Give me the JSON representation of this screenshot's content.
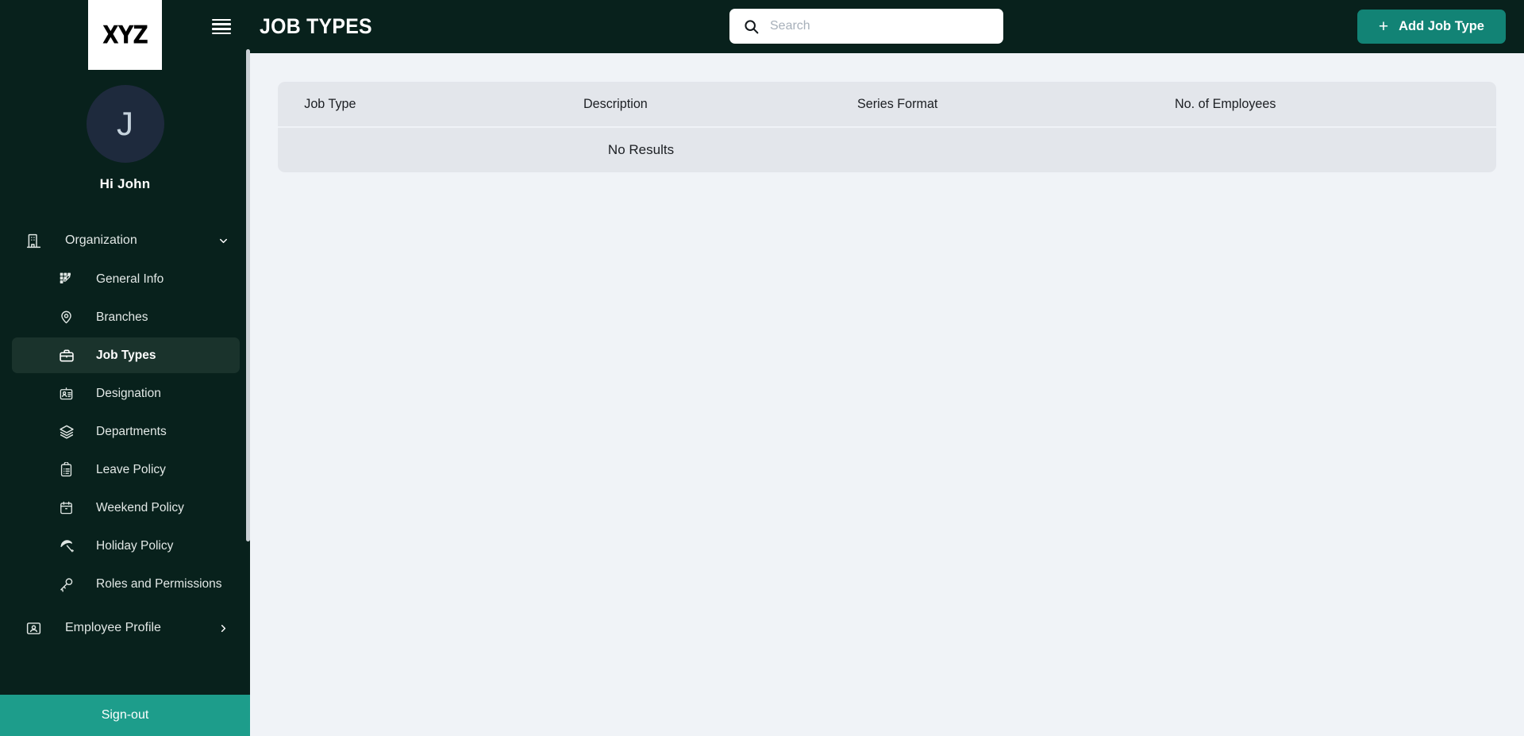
{
  "brand": {
    "logo_text": "XYZ",
    "sidebar_bg": "#08211c",
    "accent": "#128375",
    "signout_bg": "#1d9d8b",
    "content_bg": "#f0f3f7",
    "table_bg": "#e3e6eb"
  },
  "sidebar": {
    "avatar_initial": "J",
    "greeting": "Hi John",
    "group": {
      "label": "Organization",
      "icon": "building-icon",
      "chevron": "chevron-down-icon"
    },
    "items": [
      {
        "label": "General Info",
        "icon": "grid-edit-icon",
        "active": false
      },
      {
        "label": "Branches",
        "icon": "map-pin-icon",
        "active": false
      },
      {
        "label": "Job Types",
        "icon": "briefcase-icon",
        "active": true
      },
      {
        "label": "Designation",
        "icon": "id-badge-icon",
        "active": false
      },
      {
        "label": "Departments",
        "icon": "layers-icon",
        "active": false
      },
      {
        "label": "Leave Policy",
        "icon": "clipboard-list-icon",
        "active": false
      },
      {
        "label": "Weekend Policy",
        "icon": "calendar-icon",
        "active": false
      },
      {
        "label": "Holiday Policy",
        "icon": "beach-umbrella-icon",
        "active": false
      },
      {
        "label": "Roles and Permissions",
        "icon": "key-icon",
        "active": false
      }
    ],
    "employee_profile": {
      "label": "Employee Profile",
      "icon": "user-card-icon",
      "chevron": "chevron-right-icon"
    },
    "signout_label": "Sign-out"
  },
  "topbar": {
    "menu_icon": "hamburger-icon",
    "title": "JOB TYPES",
    "search": {
      "icon": "search-icon",
      "placeholder": "Search",
      "value": ""
    },
    "add_button": {
      "label": "Add Job Type",
      "icon": "plus-icon"
    }
  },
  "table": {
    "columns": [
      "Job Type",
      "Description",
      "Series Format",
      "No. of Employees"
    ],
    "rows": [],
    "empty_message": "No Results"
  }
}
